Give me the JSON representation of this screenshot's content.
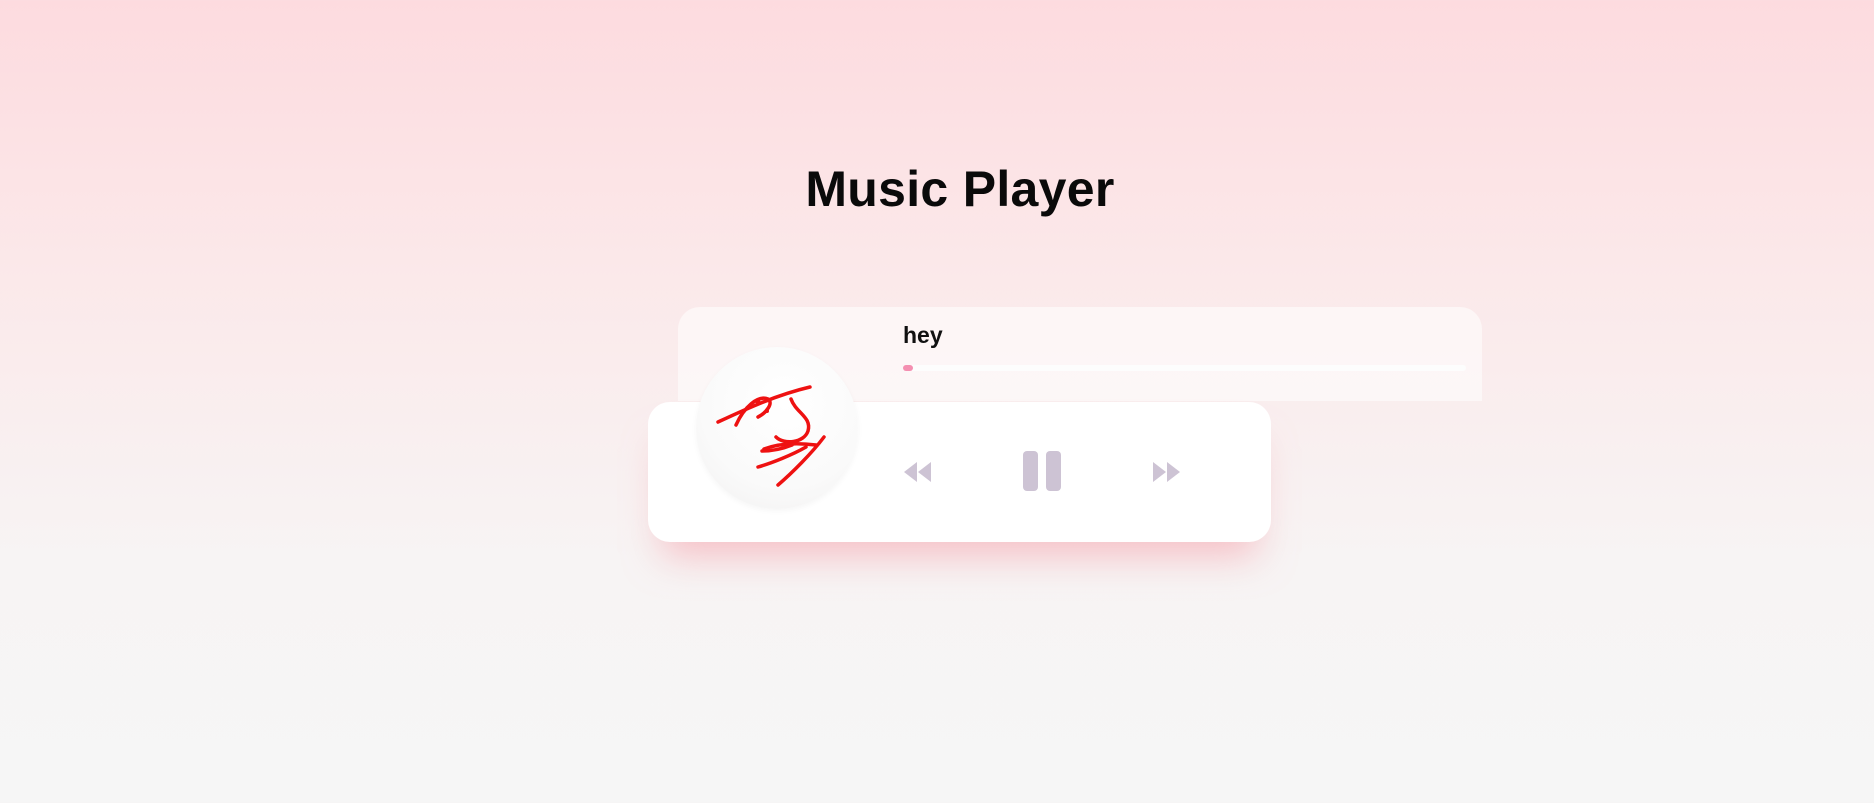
{
  "page": {
    "title": "Music Player"
  },
  "player": {
    "track_title": "hey",
    "progress_fraction": 0.017,
    "album_art_text": "hey",
    "controls": {
      "prev_icon": "backward-icon",
      "play_icon": "pause-icon",
      "next_icon": "forward-icon"
    }
  },
  "colors": {
    "accent": "#f48fb1",
    "control_icon": "#cdc3d4",
    "background_top": "#fddbdf",
    "background_bottom": "#f6f6f6",
    "album_text": "#ee1111"
  }
}
